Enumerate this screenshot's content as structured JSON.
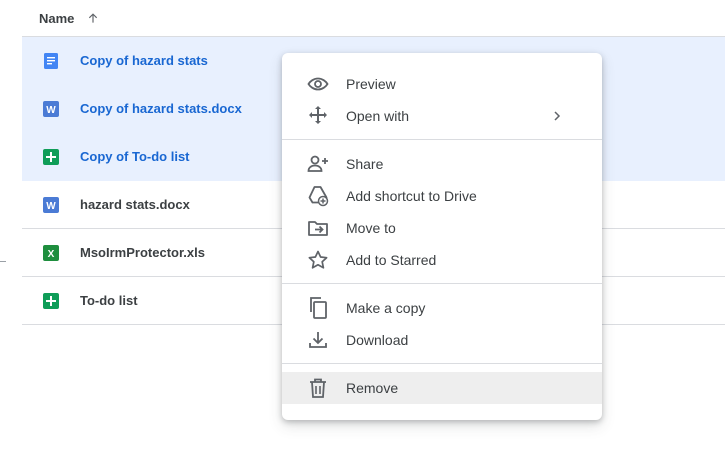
{
  "header": {
    "name_label": "Name",
    "sort_icon": "arrow-up-icon"
  },
  "files": [
    {
      "name": "Copy of hazard stats",
      "icon": "docs-icon",
      "selected": true
    },
    {
      "name": "Copy of hazard stats.docx",
      "icon": "word-icon",
      "selected": true
    },
    {
      "name": "Copy of To-do list",
      "icon": "sheets-icon",
      "selected": true
    },
    {
      "name": "hazard stats.docx",
      "icon": "word-icon",
      "selected": false
    },
    {
      "name": "MsoIrmProtector.xls",
      "icon": "excel-icon",
      "selected": false
    },
    {
      "name": "To-do list",
      "icon": "sheets-icon",
      "selected": false
    }
  ],
  "menu": {
    "items": [
      {
        "label": "Preview",
        "icon": "eye-icon"
      },
      {
        "label": "Open with",
        "icon": "move-arrows-icon"
      },
      {
        "label": "Share",
        "icon": "person-add-icon"
      },
      {
        "label": "Add shortcut to Drive",
        "icon": "drive-shortcut-icon"
      },
      {
        "label": "Move to",
        "icon": "folder-move-icon"
      },
      {
        "label": "Add to Starred",
        "icon": "star-icon"
      },
      {
        "label": "Make a copy",
        "icon": "copy-icon"
      },
      {
        "label": "Download",
        "icon": "download-icon"
      },
      {
        "label": "Remove",
        "icon": "trash-icon"
      }
    ]
  },
  "colors": {
    "selected_row_bg": "#e8f0fe",
    "selected_text": "#1967d2",
    "docs_blue": "#4285f4",
    "word_blue": "#4b7bd5",
    "sheets_green": "#0f9d58",
    "excel_green": "#1e8e3e",
    "hover_bg": "#eeeeee"
  }
}
